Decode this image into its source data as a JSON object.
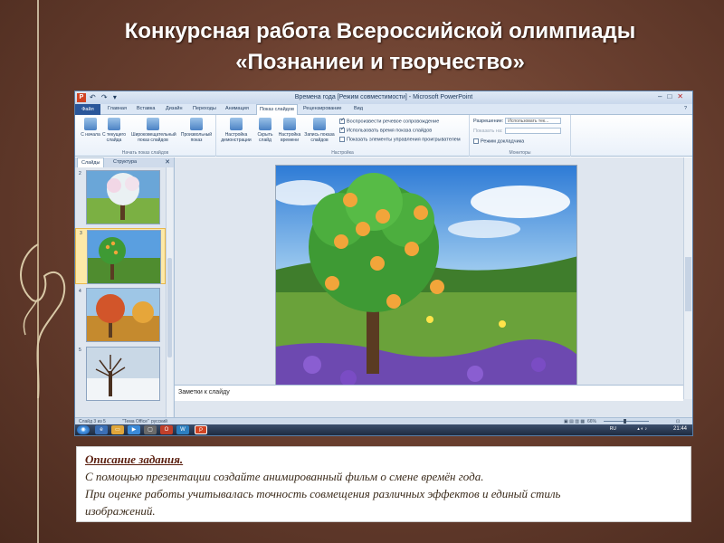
{
  "slide_title": {
    "line1": "Конкурсная работа Всероссийской олимпиады",
    "line2": "«Познаниеи и творчество»"
  },
  "window": {
    "title": "Времена года [Режим совместимости] - Microsoft PowerPoint",
    "app_icon": "P",
    "quick_access": "↶ ↷ ▾"
  },
  "tabs": [
    "Файл",
    "Главная",
    "Вставка",
    "Дизайн",
    "Переходы",
    "Анимация",
    "Показ слайдов",
    "Рецензирование",
    "Вид"
  ],
  "ribbon": {
    "group_start": {
      "label": "Начать показ слайдов",
      "buttons": [
        "С начала",
        "С текущего слайда",
        "Широковещательный показ слайдов",
        "Произвольный показ"
      ]
    },
    "group_setup": {
      "label": "Настройка",
      "buttons": [
        "Настройка демонстрации",
        "Скрыть слайд",
        "Настройка времени",
        "Запись показа слайдов"
      ],
      "checkboxes": [
        {
          "label": "Воспроизвести речевое сопровождение",
          "checked": true
        },
        {
          "label": "Использовать время показа слайдов",
          "checked": true
        },
        {
          "label": "Показать элементы управления проигрывателем",
          "checked": false
        }
      ]
    },
    "group_monitors": {
      "label": "Мониторы",
      "resolution_label": "Разрешение:",
      "resolution_value": "Использовать тек...",
      "show_on_label": "Показать на:",
      "presenter_label": "Режим докладчика"
    }
  },
  "panel": {
    "tab_slides": "Слайды",
    "tab_outline": "Структура",
    "close": "✕",
    "thumbnails": [
      {
        "num": "2",
        "season": "spring"
      },
      {
        "num": "3",
        "season": "summer",
        "selected": true
      },
      {
        "num": "4",
        "season": "autumn"
      },
      {
        "num": "5",
        "season": "winter"
      }
    ]
  },
  "notes_placeholder": "Заметки к слайду",
  "status": {
    "slide_info": "Слайд 3 из 5",
    "theme": "\"Тема Office\"",
    "language": "русский",
    "zoom": "66%"
  },
  "taskbar": {
    "lang": "RU",
    "time": "21:44"
  },
  "description": {
    "title": "Описание задания.",
    "line1": "С помощью презентации создайте анимированный фильм о смене времён года.",
    "line2": "При оценке работы учитывалась точность совмещения различных эффектов и единый стиль",
    "line3": "изображений."
  },
  "colors": {
    "background": "#6b4030",
    "ribbon_file_tab": "#2b579a",
    "apple": "#f2a53a",
    "selected_thumb": "#fde9a8"
  }
}
